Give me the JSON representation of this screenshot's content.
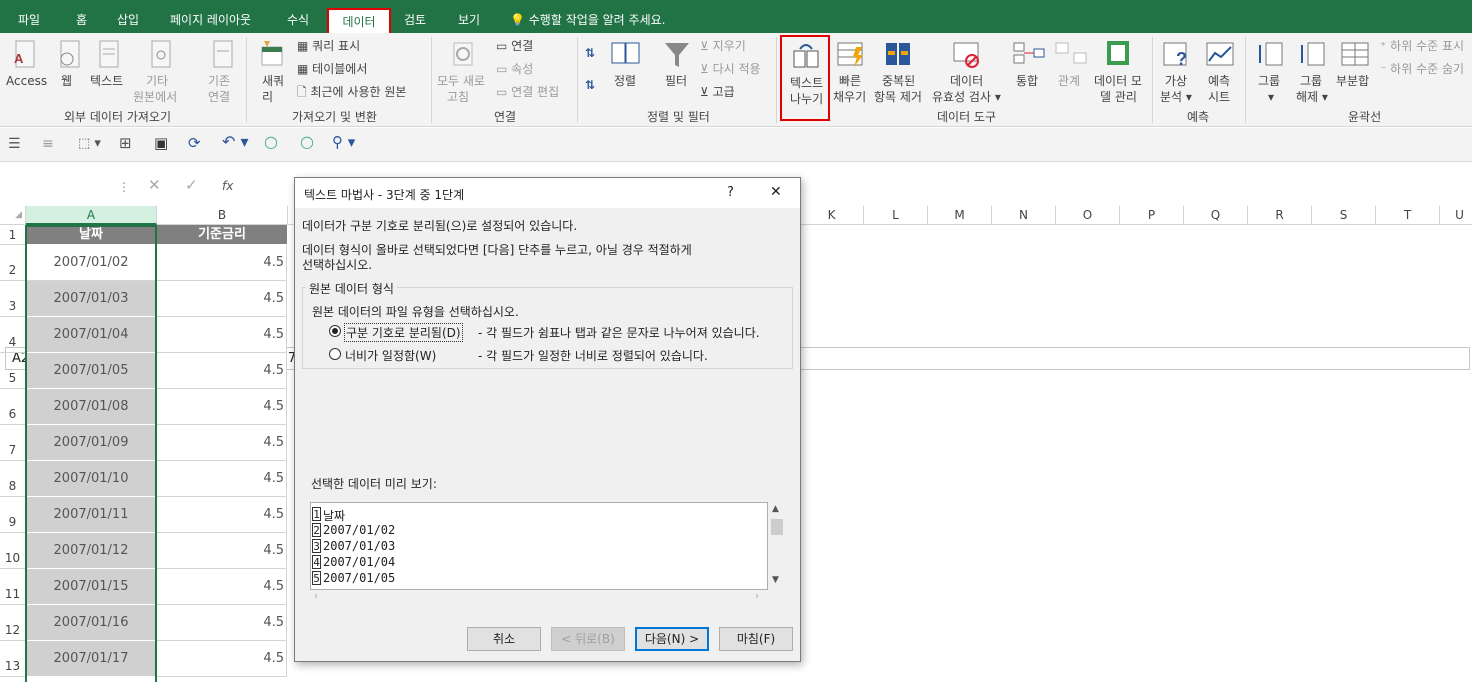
{
  "tabs": {
    "file": "파일",
    "home": "홈",
    "insert": "삽입",
    "layout": "페이지 레이아웃",
    "formulas": "수식",
    "data": "데이터",
    "review": "검토",
    "view": "보기"
  },
  "tellme": "수행할 작업을 알려 주세요.",
  "ribbon": {
    "ext": {
      "access": "Access",
      "web": "웹",
      "text": "텍스트",
      "other1": "기타",
      "other2": "원본에서",
      "existing1": "기존",
      "existing2": "연결",
      "group": "외부 데이터 가져오기"
    },
    "get": {
      "newq1": "새쿼",
      "newq2": "리",
      "show_queries": "쿼리 표시",
      "from_table": "테이블에서",
      "recent": "최근에 사용한 원본",
      "group": "가져오기 및 변환"
    },
    "conn": {
      "refresh1": "모두 새로",
      "refresh2": "고침",
      "connections": "연결",
      "properties": "속성",
      "edit_links": "연결 편집",
      "group": "연결"
    },
    "sort": {
      "sort": "정렬",
      "filter": "필터",
      "clear": "지우기",
      "reapply": "다시 적용",
      "advanced": "고급",
      "group": "정렬 및 필터"
    },
    "tools": {
      "ttc1": "텍스트",
      "ttc2": "나누기",
      "flash1": "빠른",
      "flash2": "채우기",
      "dup1": "중복된",
      "dup2": "항목 제거",
      "valid1": "데이터",
      "valid2": "유효성 검사",
      "consol": "통합",
      "rel": "관계",
      "model1": "데이터 모",
      "model2": "델 관리",
      "group": "데이터 도구"
    },
    "forecast": {
      "whatif1": "가상",
      "whatif2": "분석",
      "sheet1": "예측",
      "sheet2": "시트",
      "group": "예측"
    },
    "outline": {
      "group1": "그룹",
      "ungroup1": "그룹",
      "ungroup2": "해제",
      "subtotal": "부분합",
      "show": "하위 수준 표시",
      "hide": "하위 수준 숨기",
      "group": "윤곽선"
    }
  },
  "formula_bar": {
    "namebox": "A2",
    "fx": "fx",
    "content": "2007"
  },
  "columns": [
    "A",
    "B",
    "K",
    "L",
    "M",
    "N",
    "O",
    "P",
    "Q",
    "R",
    "S",
    "T",
    "U"
  ],
  "sheet": {
    "header_a": "날짜",
    "header_b": "기준금리",
    "rows": [
      {
        "n": "1",
        "a": "",
        "b": ""
      },
      {
        "n": "2",
        "a": "2007/01/02",
        "b": "4.5"
      },
      {
        "n": "3",
        "a": "2007/01/03",
        "b": "4.5"
      },
      {
        "n": "4",
        "a": "2007/01/04",
        "b": "4.5"
      },
      {
        "n": "5",
        "a": "2007/01/05",
        "b": "4.5"
      },
      {
        "n": "6",
        "a": "2007/01/08",
        "b": "4.5"
      },
      {
        "n": "7",
        "a": "2007/01/09",
        "b": "4.5"
      },
      {
        "n": "8",
        "a": "2007/01/10",
        "b": "4.5"
      },
      {
        "n": "9",
        "a": "2007/01/11",
        "b": "4.5"
      },
      {
        "n": "10",
        "a": "2007/01/12",
        "b": "4.5"
      },
      {
        "n": "11",
        "a": "2007/01/15",
        "b": "4.5"
      },
      {
        "n": "12",
        "a": "2007/01/16",
        "b": "4.5"
      },
      {
        "n": "13",
        "a": "2007/01/17",
        "b": "4.5"
      }
    ]
  },
  "dialog": {
    "title": "텍스트 마법사 - 3단계 중 1단계",
    "help": "?",
    "close": "✕",
    "line1": "데이터가 구분 기호로 분리됨(으)로 설정되어 있습니다.",
    "line2": "데이터 형식이 올바로 선택되었다면 [다음] 단추를 누르고, 아닐 경우 적절하게",
    "line3": "선택하십시오.",
    "fieldset": "원본 데이터 형식",
    "choose": "원본 데이터의 파일 유형을 선택하십시오.",
    "opt1": "구분 기호로 분리됨(D)",
    "opt1_desc": "- 각 필드가 쉼표나 탭과 같은 문자로 나누어져 있습니다.",
    "opt2": "너비가 일정함(W)",
    "opt2_desc": "- 각 필드가 일정한 너비로 정렬되어 있습니다.",
    "preview_label": "선택한 데이터 미리 보기:",
    "preview": [
      {
        "n": "1",
        "t": "날짜"
      },
      {
        "n": "2",
        "t": "2007/01/02"
      },
      {
        "n": "3",
        "t": "2007/01/03"
      },
      {
        "n": "4",
        "t": "2007/01/04"
      },
      {
        "n": "5",
        "t": "2007/01/05"
      }
    ],
    "cancel": "취소",
    "back": "< 뒤로(B)",
    "next": "다음(N) >",
    "finish": "마침(F)"
  },
  "colors": {
    "excel_green": "#217346",
    "highlight_red": "#e00000"
  }
}
